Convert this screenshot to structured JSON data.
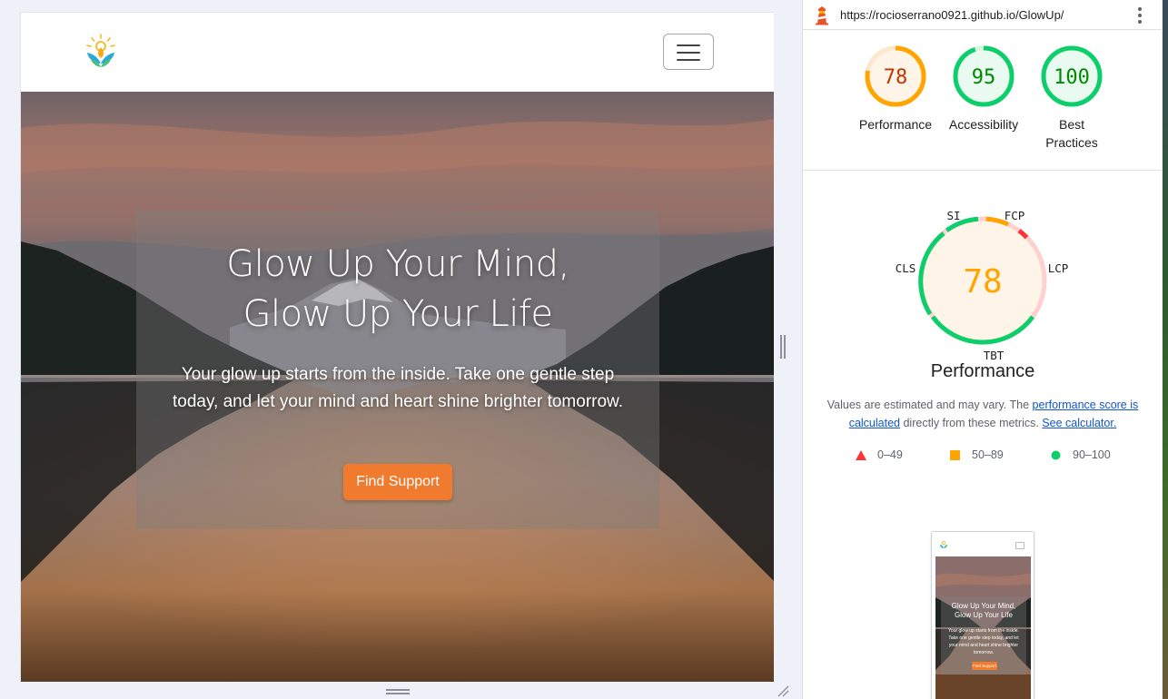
{
  "site": {
    "hero_title": "Glow Up Your Mind, Glow Up Your Life",
    "hero_text": "Your glow up starts from the inside. Take one gentle step today, and let your mind and heart shine brighter tomorrow.",
    "cta_label": "Find Support",
    "accent_color": "#f07b2e"
  },
  "lighthouse": {
    "url": "https://rocioserrano0921.github.io/GlowUp/",
    "scores": [
      {
        "label": "Performance",
        "value": "78",
        "color": "#e67700",
        "ring": "#ffa400"
      },
      {
        "label": "Accessibility",
        "value": "95",
        "color": "#008800",
        "ring": "#0cce6b"
      },
      {
        "label": "Best Practices",
        "value": "100",
        "color": "#008800",
        "ring": "#0cce6b"
      }
    ],
    "performance": {
      "score": "78",
      "title": "Performance",
      "metrics": [
        "SI",
        "FCP",
        "LCP",
        "TBT",
        "CLS"
      ],
      "note_prefix": "Values are estimated and may vary. The ",
      "note_link1": "performance score is calculated",
      "note_mid": " directly from these metrics. ",
      "note_link2": "See calculator."
    },
    "legend": {
      "fail": "0–49",
      "average": "50–89",
      "pass": "90–100"
    },
    "icons": [
      "lighthouse-icon",
      "kebab-menu-icon",
      "triangle-icon",
      "square-icon",
      "circle-icon",
      "hamburger-icon"
    ]
  }
}
